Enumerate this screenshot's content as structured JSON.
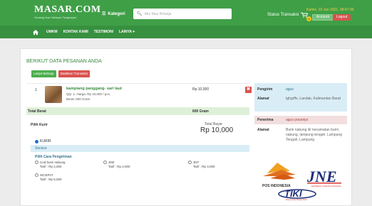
{
  "header": {
    "brand_title": "MASAR.COM",
    "brand_tagline": "Gudang Ikan Nelayan Tangkapan",
    "kategori_label": "Kategori",
    "search_placeholder": "Aku Mau Belanja",
    "status_label": "Status Transaksi",
    "datetime": "Kamis, 10 Jun 2021, 08:47:30",
    "cart_count": "0",
    "account_label": "Account",
    "logout_label": "Logout"
  },
  "nav": {
    "items": [
      "UMKM",
      "KONTAK KAMI",
      "TESTIMONI",
      "LAINYA ▾"
    ]
  },
  "page": {
    "title": "BERIKUT DATA PESANAN ANDA",
    "lanjut_label": "Lanjut Belanja",
    "batal_label": "Batalkan Transaksi"
  },
  "order": {
    "item_no": "1",
    "item_name": "kampiang panggang- sari laut",
    "item_qty": "Qty: 1, Harga: Rp 10,000 / pcs,",
    "item_berat": "Berat: 600 Gram",
    "item_price": "Rp 10,000",
    "delete_label": "✖",
    "total_berat_label": "Total Berat",
    "total_berat_value": "600 Gram"
  },
  "kurir": {
    "pilih_label": "Pilih Kurir",
    "total_bayar_label": "Total Bayar",
    "total_bayar_value": "Rp 10,000",
    "option": "KURIR",
    "service_label": "Service",
    "cara_label": "Pilih Cara Pengiriman",
    "shipping": [
      {
        "name": "Cod bumi nabung",
        "tarif": "Tarif : Rp 2,000"
      },
      {
        "name": "JNE",
        "tarif": "Tarif : Rp 2,000"
      },
      {
        "name": "JNT",
        "tarif": "Tarif : Rp 3,000"
      },
      {
        "name": "SICEPAT",
        "tarif": "Tarif : Rp 5,000"
      }
    ]
  },
  "pengirim": {
    "label_pengirim": "Pengirim",
    "value_pengirim": "agus",
    "label_alamat": "Alamat",
    "value_alamat": "tghgrffs, Landak, Kalimantan Barat"
  },
  "penerima": {
    "label_penerima": "Penerima",
    "value_penerima": "agus prasetyo",
    "label_alamat": "Alamat",
    "value_alamat": "Bumi nabung ilir kecamatan bumi nabung, lampung tengah. Lampung Tengah, Lampung"
  },
  "logos": {
    "pos": "POS INDONESIA",
    "jne": "JNE",
    "jne_tag": "EXPRESS ACROSS NATIONS",
    "tiki": "TIKI",
    "tiki_tag": "Hanya Satu Titipan Kilat"
  },
  "colors": {
    "green": "#3f9f47",
    "nav_green": "#37903f",
    "red": "#d9534f",
    "info_blue": "#d9edf7",
    "success_green": "#def0d8"
  }
}
